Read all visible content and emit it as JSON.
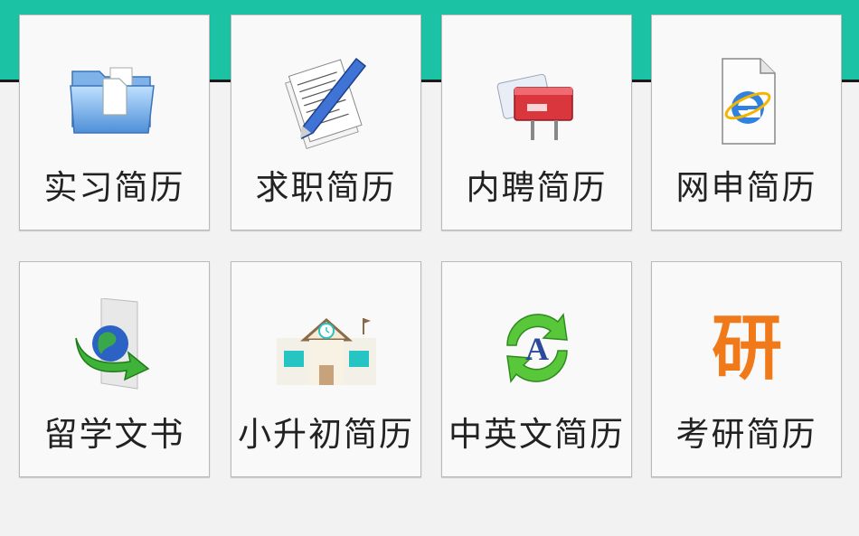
{
  "colors": {
    "header": "#1bc2a3",
    "background": "#f2f2f2",
    "tile": "#f9f9f9"
  },
  "tiles": [
    {
      "label": "实习简历",
      "icon": "folder-icon"
    },
    {
      "label": "求职简历",
      "icon": "pen-document-icon"
    },
    {
      "label": "内聘简历",
      "icon": "mailbox-icon"
    },
    {
      "label": "网申简历",
      "icon": "ie-document-icon"
    },
    {
      "label": "留学文书",
      "icon": "globe-arrow-icon"
    },
    {
      "label": "小升初简历",
      "icon": "school-building-icon"
    },
    {
      "label": "中英文简历",
      "icon": "translate-icon"
    },
    {
      "label": "考研简历",
      "icon": "yan-character-icon",
      "icon_text": "研"
    }
  ]
}
